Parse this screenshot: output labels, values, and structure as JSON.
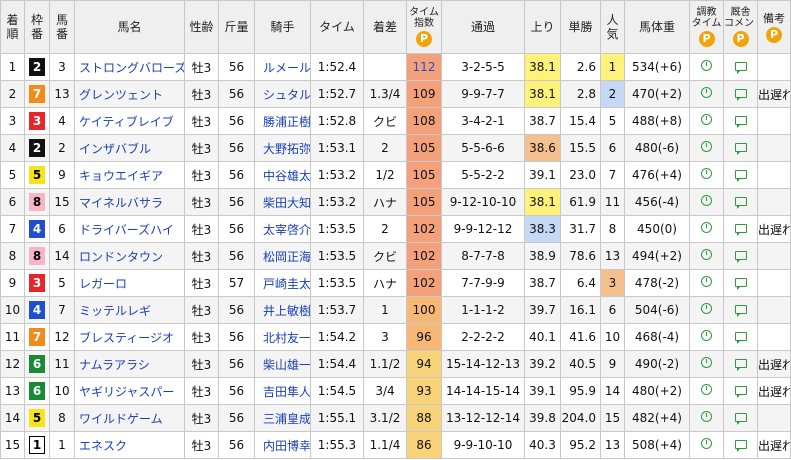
{
  "headers": {
    "rank": [
      "着",
      "順"
    ],
    "waku": [
      "枠",
      "番"
    ],
    "num": [
      "馬",
      "番"
    ],
    "name": "馬名",
    "sexage": "性齢",
    "weight": "斤量",
    "jockey": "騎手",
    "time": "タイム",
    "margin": "着差",
    "index": [
      "タイム",
      "指数"
    ],
    "passing": "通過",
    "last": "上り",
    "odds": "単勝",
    "pop": [
      "人",
      "気"
    ],
    "body": "馬体重",
    "training": [
      "調教",
      "タイム"
    ],
    "comment": [
      "厩舎",
      "コメント"
    ],
    "remarks": "備考",
    "p_badge": "P"
  },
  "colors": {
    "waku": {
      "1": {
        "bg": "#ffffff",
        "fg": "#000000",
        "border": "#000000"
      },
      "2": {
        "bg": "#111111",
        "fg": "#ffffff",
        "border": "#111111"
      },
      "3": {
        "bg": "#e8262a",
        "fg": "#ffffff",
        "border": "#e8262a"
      },
      "4": {
        "bg": "#1f4fcf",
        "fg": "#ffffff",
        "border": "#1f4fcf"
      },
      "5": {
        "bg": "#f7e418",
        "fg": "#000000",
        "border": "#f7e418"
      },
      "6": {
        "bg": "#1a8a35",
        "fg": "#ffffff",
        "border": "#1a8a35"
      },
      "7": {
        "bg": "#f28a1c",
        "fg": "#ffffff",
        "border": "#f28a1c"
      },
      "8": {
        "bg": "#f6b6c8",
        "fg": "#000000",
        "border": "#f6b6c8"
      }
    },
    "index_high": "#f4a07a",
    "index_mid": "#f6b777",
    "index_low": "#f9d37a",
    "index_top_text": "#2550c8",
    "last_yellow": "#fff27a",
    "last_orange": "#f3c08e",
    "last_blue": "#c5d8f5",
    "pop_yellow": "#fff27a",
    "pop_blue": "#c5d8f5",
    "pop_orange": "#f3c08e",
    "icon_green": "#2e9b3a"
  },
  "rows": [
    {
      "rank": "1",
      "waku": "2",
      "num": "3",
      "name": "ストロングバローズ",
      "sexage": "牡3",
      "weight": "56",
      "jockey": "ルメール",
      "time": "1:52.4",
      "margin": "",
      "index": "112",
      "passing": "3-2-5-5",
      "last": "38.1",
      "last_hl": "yellow",
      "odds": "2.6",
      "pop": "1",
      "pop_hl": "yellow",
      "body": "534(+6)",
      "remarks": ""
    },
    {
      "rank": "2",
      "waku": "7",
      "num": "13",
      "name": "グレンツェント",
      "sexage": "牡3",
      "weight": "56",
      "jockey": "シュタル",
      "time": "1:52.7",
      "margin": "1.3/4",
      "index": "109",
      "passing": "9-9-7-7",
      "last": "38.1",
      "last_hl": "yellow",
      "odds": "2.8",
      "pop": "2",
      "pop_hl": "blue",
      "body": "470(+2)",
      "remarks": "出遅れ"
    },
    {
      "rank": "3",
      "waku": "3",
      "num": "4",
      "name": "ケイティブレイブ",
      "sexage": "牡3",
      "weight": "56",
      "jockey": "勝浦正樹",
      "time": "1:52.8",
      "margin": "クビ",
      "index": "108",
      "passing": "3-4-2-1",
      "last": "38.7",
      "last_hl": "",
      "odds": "15.4",
      "pop": "5",
      "pop_hl": "",
      "body": "488(+8)",
      "remarks": ""
    },
    {
      "rank": "4",
      "waku": "2",
      "num": "2",
      "name": "インザバブル",
      "sexage": "牡3",
      "weight": "56",
      "jockey": "大野拓弥",
      "time": "1:53.1",
      "margin": "2",
      "index": "105",
      "passing": "5-5-6-6",
      "last": "38.6",
      "last_hl": "orange",
      "odds": "15.5",
      "pop": "6",
      "pop_hl": "",
      "body": "480(-6)",
      "remarks": ""
    },
    {
      "rank": "5",
      "waku": "5",
      "num": "9",
      "name": "キョウエイギア",
      "sexage": "牡3",
      "weight": "56",
      "jockey": "中谷雄太",
      "time": "1:53.2",
      "margin": "1/2",
      "index": "105",
      "passing": "5-5-2-2",
      "last": "39.1",
      "last_hl": "",
      "odds": "23.0",
      "pop": "7",
      "pop_hl": "",
      "body": "476(+4)",
      "remarks": ""
    },
    {
      "rank": "6",
      "waku": "8",
      "num": "15",
      "name": "マイネルバサラ",
      "sexage": "牡3",
      "weight": "56",
      "jockey": "柴田大知",
      "time": "1:53.2",
      "margin": "ハナ",
      "index": "105",
      "passing": "9-12-10-10",
      "last": "38.1",
      "last_hl": "yellow",
      "odds": "61.9",
      "pop": "11",
      "pop_hl": "",
      "body": "456(-4)",
      "remarks": ""
    },
    {
      "rank": "7",
      "waku": "4",
      "num": "6",
      "name": "ドライバーズハイ",
      "sexage": "牡3",
      "weight": "56",
      "jockey": "太宰啓介",
      "time": "1:53.5",
      "margin": "2",
      "index": "102",
      "passing": "9-9-12-12",
      "last": "38.3",
      "last_hl": "blue",
      "odds": "31.7",
      "pop": "8",
      "pop_hl": "",
      "body": "450(0)",
      "remarks": "出遅れ"
    },
    {
      "rank": "8",
      "waku": "8",
      "num": "14",
      "name": "ロンドンタウン",
      "sexage": "牡3",
      "weight": "56",
      "jockey": "松岡正海",
      "time": "1:53.5",
      "margin": "クビ",
      "index": "102",
      "passing": "8-7-7-8",
      "last": "38.9",
      "last_hl": "",
      "odds": "78.6",
      "pop": "13",
      "pop_hl": "",
      "body": "494(+2)",
      "remarks": ""
    },
    {
      "rank": "9",
      "waku": "3",
      "num": "5",
      "name": "レガーロ",
      "sexage": "牡3",
      "weight": "57",
      "jockey": "戸崎圭太",
      "time": "1:53.5",
      "margin": "ハナ",
      "index": "102",
      "passing": "7-7-9-9",
      "last": "38.7",
      "last_hl": "",
      "odds": "6.4",
      "pop": "3",
      "pop_hl": "orange",
      "body": "478(-2)",
      "remarks": ""
    },
    {
      "rank": "10",
      "waku": "4",
      "num": "7",
      "name": "ミッテルレギ",
      "sexage": "牡3",
      "weight": "56",
      "jockey": "井上敏樹",
      "time": "1:53.7",
      "margin": "1",
      "index": "100",
      "passing": "1-1-1-2",
      "last": "39.7",
      "last_hl": "",
      "odds": "16.1",
      "pop": "6",
      "pop_hl": "",
      "body": "504(-6)",
      "remarks": ""
    },
    {
      "rank": "11",
      "waku": "7",
      "num": "12",
      "name": "ブレスティージオ",
      "sexage": "牡3",
      "weight": "56",
      "jockey": "北村友一",
      "time": "1:54.2",
      "margin": "3",
      "index": "96",
      "passing": "2-2-2-2",
      "last": "40.1",
      "last_hl": "",
      "odds": "41.6",
      "pop": "10",
      "pop_hl": "",
      "body": "468(-4)",
      "remarks": ""
    },
    {
      "rank": "12",
      "waku": "6",
      "num": "11",
      "name": "ナムラアラシ",
      "sexage": "牡3",
      "weight": "56",
      "jockey": "柴山雄一",
      "time": "1:54.4",
      "margin": "1.1/2",
      "index": "94",
      "passing": "15-14-12-13",
      "last": "39.2",
      "last_hl": "",
      "odds": "40.5",
      "pop": "9",
      "pop_hl": "",
      "body": "490(-2)",
      "remarks": "出遅れ"
    },
    {
      "rank": "13",
      "waku": "6",
      "num": "10",
      "name": "ヤギリジャスパー",
      "sexage": "牡3",
      "weight": "56",
      "jockey": "吉田隼人",
      "time": "1:54.5",
      "margin": "3/4",
      "index": "93",
      "passing": "14-14-15-14",
      "last": "39.1",
      "last_hl": "",
      "odds": "95.9",
      "pop": "14",
      "pop_hl": "",
      "body": "480(+2)",
      "remarks": "出遅れ"
    },
    {
      "rank": "14",
      "waku": "5",
      "num": "8",
      "name": "ワイルドゲーム",
      "sexage": "牡3",
      "weight": "56",
      "jockey": "三浦皇成",
      "time": "1:55.1",
      "margin": "3.1/2",
      "index": "88",
      "passing": "13-12-12-14",
      "last": "39.8",
      "last_hl": "",
      "odds": "204.0",
      "pop": "15",
      "pop_hl": "",
      "body": "482(+4)",
      "remarks": ""
    },
    {
      "rank": "15",
      "waku": "1",
      "num": "1",
      "name": "エネスク",
      "sexage": "牡3",
      "weight": "56",
      "jockey": "内田博幸",
      "time": "1:55.3",
      "margin": "1.1/4",
      "index": "86",
      "passing": "9-9-10-10",
      "last": "40.3",
      "last_hl": "",
      "odds": "95.2",
      "pop": "13",
      "pop_hl": "",
      "body": "508(+4)",
      "remarks": "出遅れ"
    }
  ]
}
